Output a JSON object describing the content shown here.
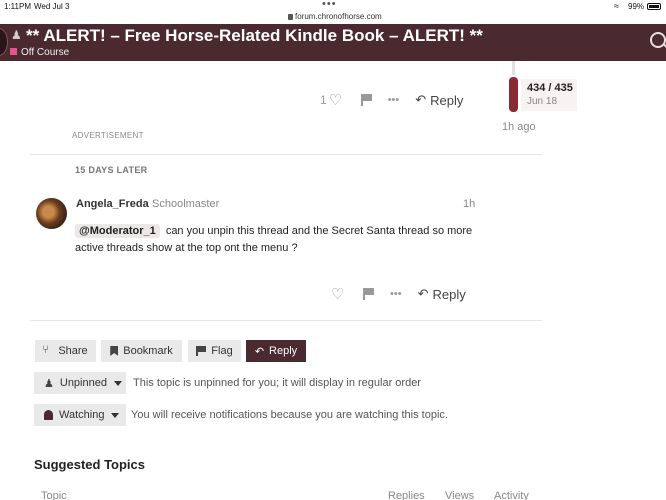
{
  "status_bar": {
    "time": "1:11PM",
    "date": "Wed Jul 3",
    "url": "forum.chronofhorse.com",
    "battery": "99%"
  },
  "header": {
    "title": "** ALERT! – Free Horse-Related Kindle Book – ALERT! **",
    "category": "Off Course",
    "category_color": "#e45590",
    "bg_color": "#4a2a2f"
  },
  "timeline": {
    "position": "434 / 435",
    "date": "Jun 18",
    "last_post_ago": "1h ago"
  },
  "first_post": {
    "like_count": "1",
    "reply_label": "Reply"
  },
  "advertisement_label": "ADVERTISEMENT",
  "gap_label": "15 DAYS LATER",
  "post": {
    "username": "Angela_Freda",
    "user_title": "Schoolmaster",
    "time": "1h",
    "mention": "@Moderator_1",
    "body": "can you unpin this thread and the Secret Santa thread so more active threads show at the top ont the menu ?",
    "reply_label": "Reply"
  },
  "topic_buttons": {
    "share": "Share",
    "bookmark": "Bookmark",
    "flag": "Flag",
    "reply": "Reply"
  },
  "notifications": {
    "pin_button": "Unpinned",
    "pin_text": "This topic is unpinned for you; it will display in regular order",
    "watch_button": "Watching",
    "watch_text": "You will receive notifications because you are watching this topic."
  },
  "suggested": {
    "title": "Suggested Topics",
    "columns": [
      "Topic",
      "Replies",
      "Views",
      "Activity"
    ]
  }
}
